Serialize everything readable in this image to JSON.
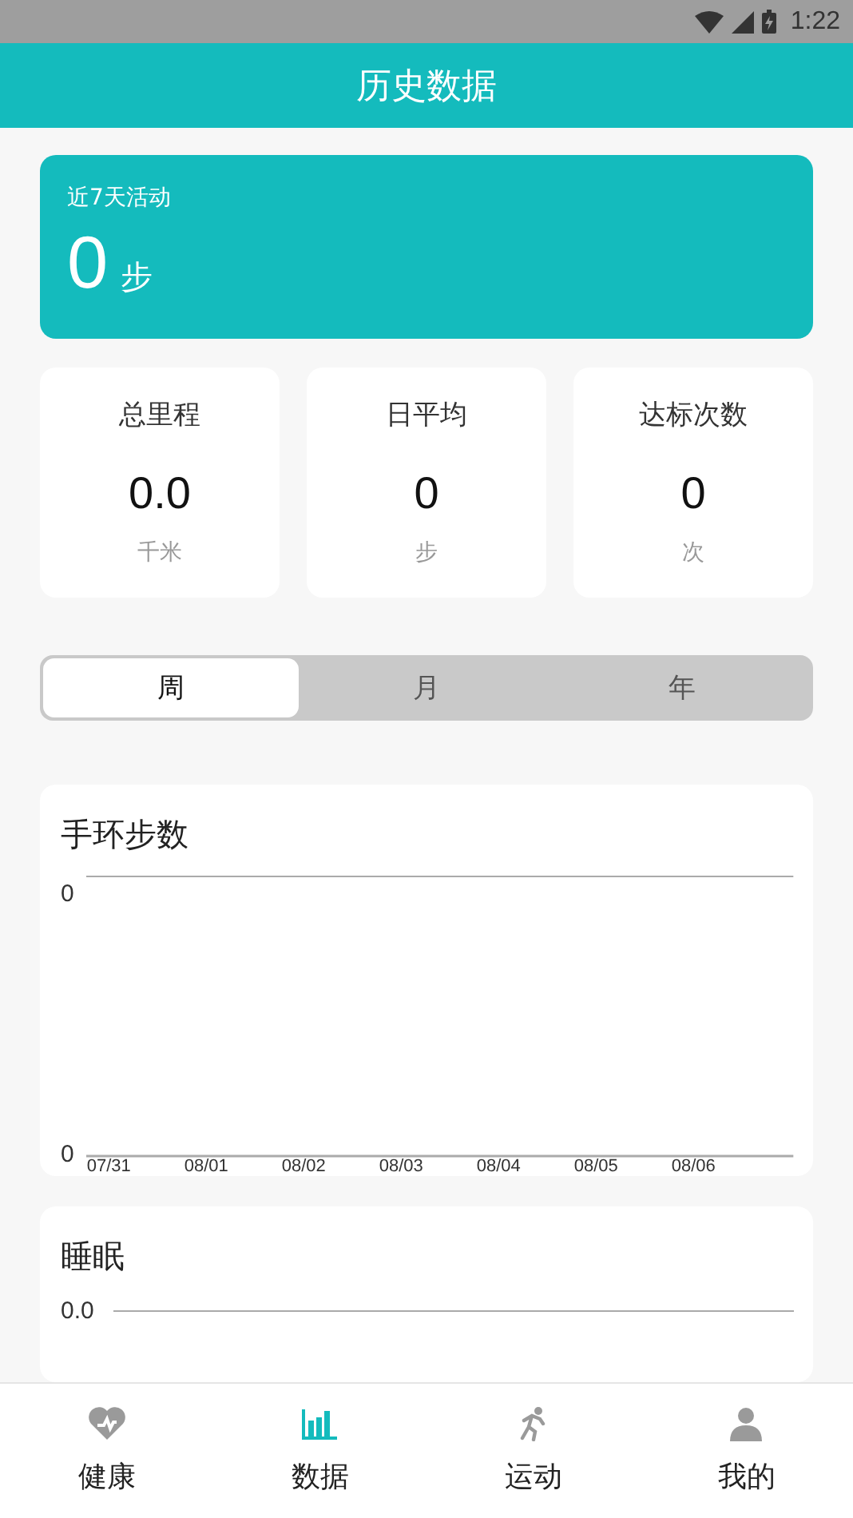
{
  "status_bar": {
    "time": "1:22"
  },
  "header": {
    "title": "历史数据"
  },
  "summary": {
    "label": "近7天活动",
    "value": "0",
    "unit": "步"
  },
  "stats": [
    {
      "label": "总里程",
      "value": "0.0",
      "unit": "千米"
    },
    {
      "label": "日平均",
      "value": "0",
      "unit": "步"
    },
    {
      "label": "达标次数",
      "value": "0",
      "unit": "次"
    }
  ],
  "period_tabs": [
    {
      "label": "周",
      "selected": true
    },
    {
      "label": "月",
      "selected": false
    },
    {
      "label": "年",
      "selected": false
    }
  ],
  "charts": [
    {
      "kind": "line",
      "title": "手环步数",
      "y_labels": [
        "0",
        "0"
      ],
      "x_labels": [
        "07/31",
        "08/01",
        "08/02",
        "08/03",
        "08/04",
        "08/05",
        "08/06"
      ]
    },
    {
      "kind": "bar",
      "title": "睡眠",
      "y_labels": [
        "0.0"
      ]
    }
  ],
  "nav": [
    {
      "label": "健康",
      "kind": "health",
      "selected": false
    },
    {
      "label": "数据",
      "kind": "data",
      "selected": true
    },
    {
      "label": "运动",
      "kind": "sport",
      "selected": false
    },
    {
      "label": "我的",
      "kind": "profile",
      "selected": false
    }
  ]
}
